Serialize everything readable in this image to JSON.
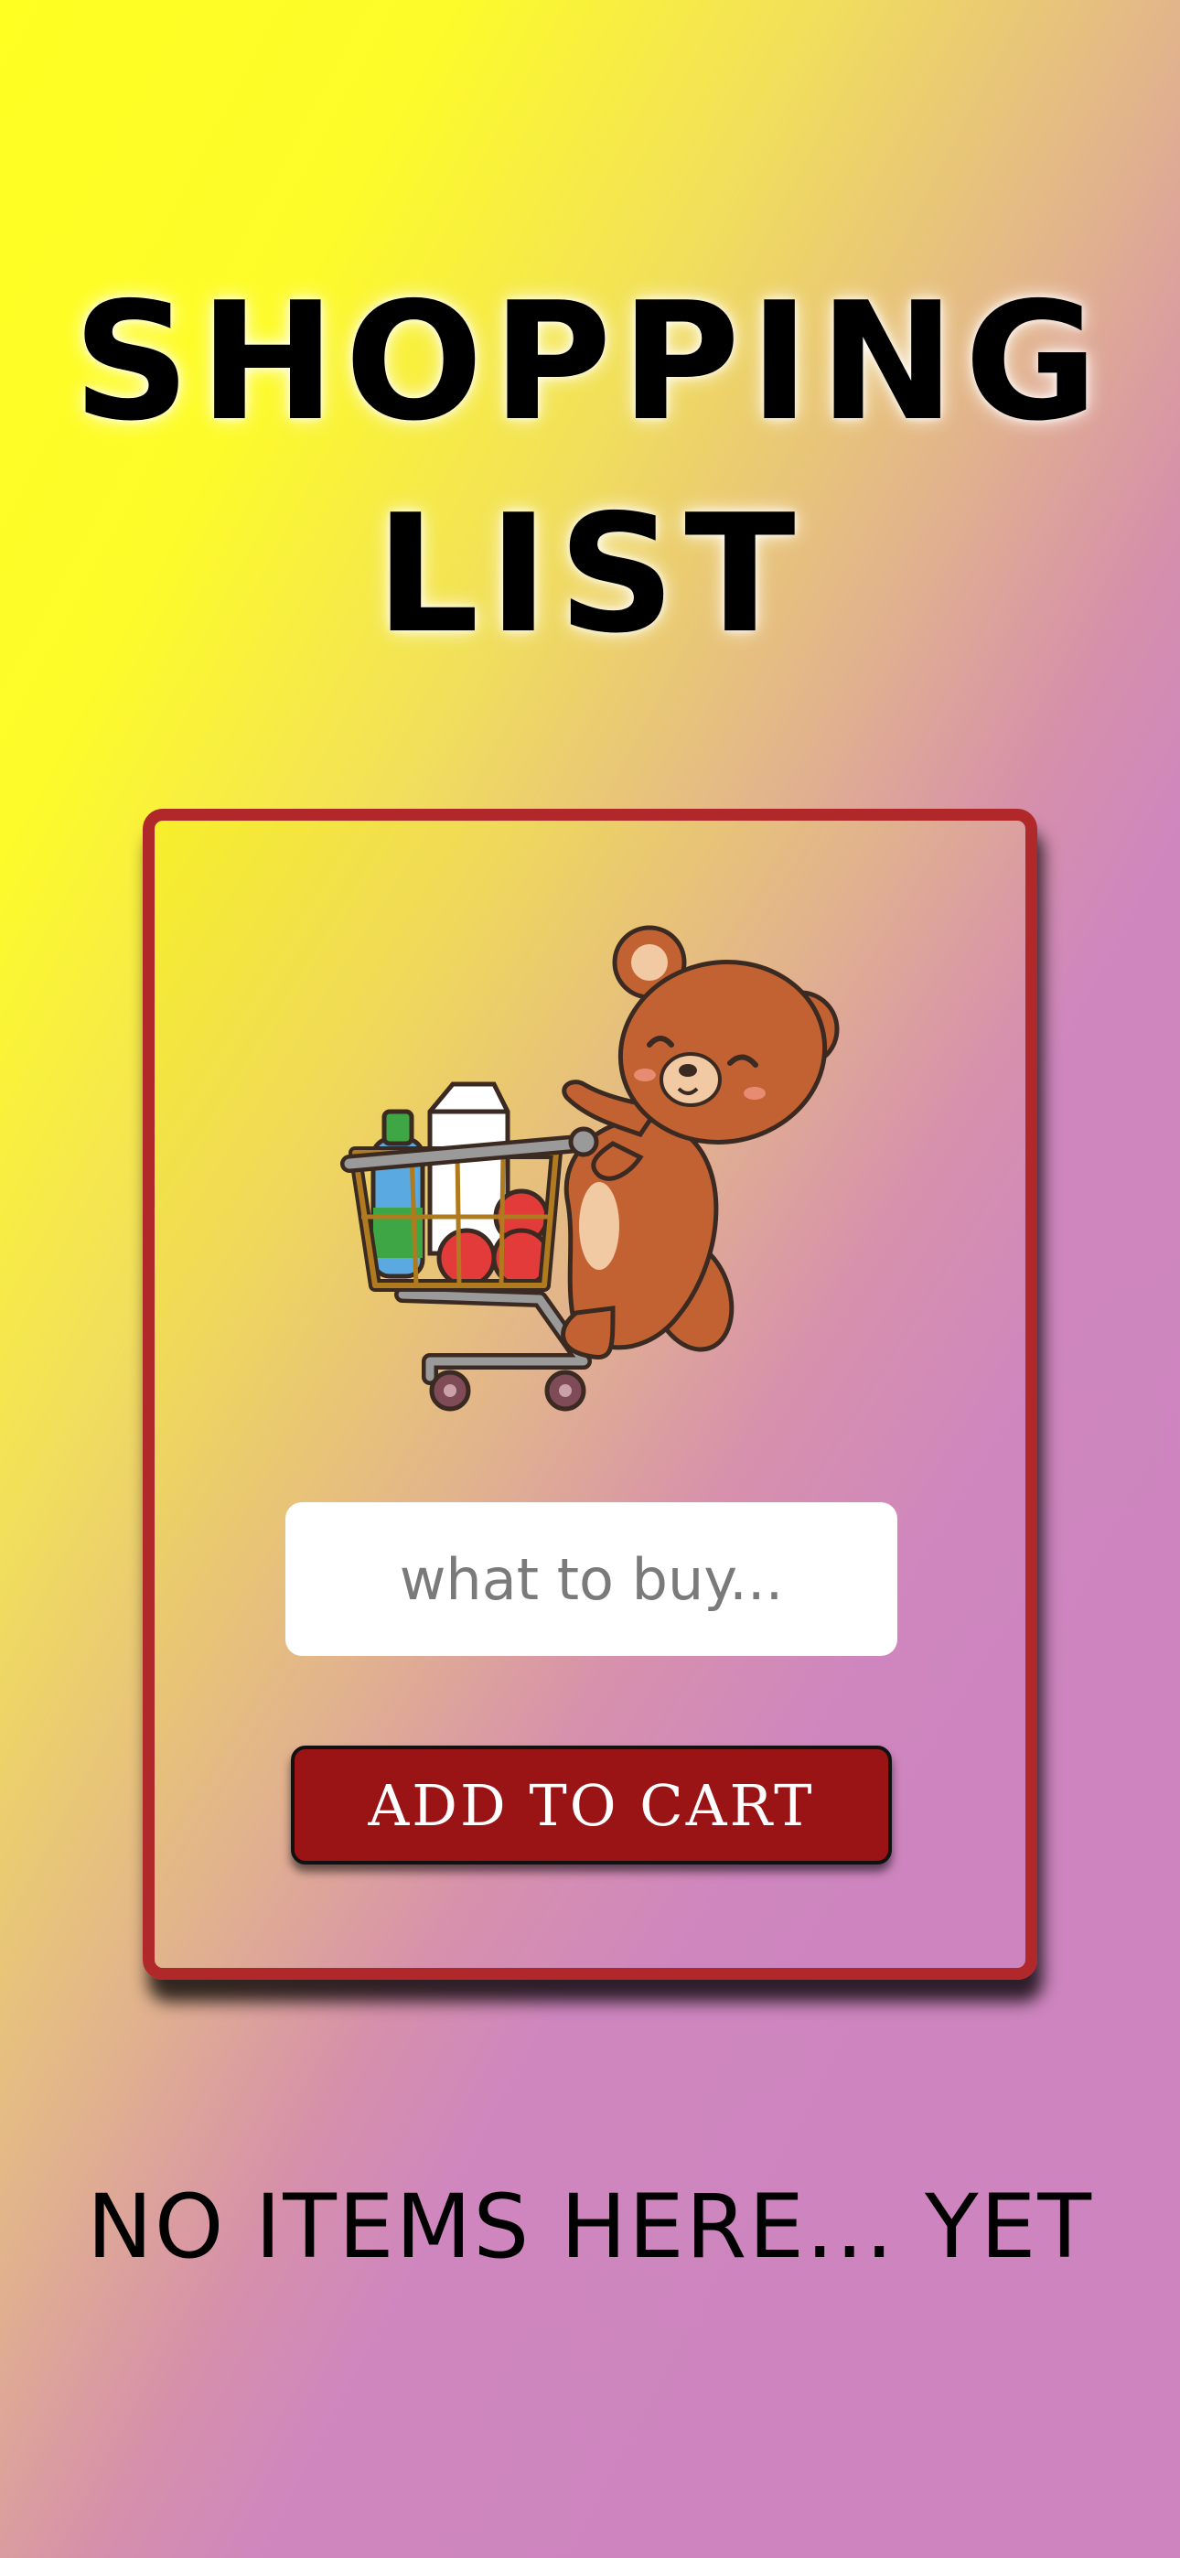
{
  "app": {
    "title_line1": "SHOPPING",
    "title_line2": "LIST"
  },
  "form": {
    "input_placeholder": "what to buy...",
    "input_value": "",
    "add_button_label": "ADD TO CART"
  },
  "list": {
    "empty_message": "NO ITEMS HERE... YET",
    "items": []
  },
  "illustration": {
    "icon": "bear-shopping-cart-icon"
  },
  "colors": {
    "accent": "#9a1416",
    "card_border": "#b0282a",
    "gradient_start": "#ffff22",
    "gradient_end": "#cd84bf"
  }
}
